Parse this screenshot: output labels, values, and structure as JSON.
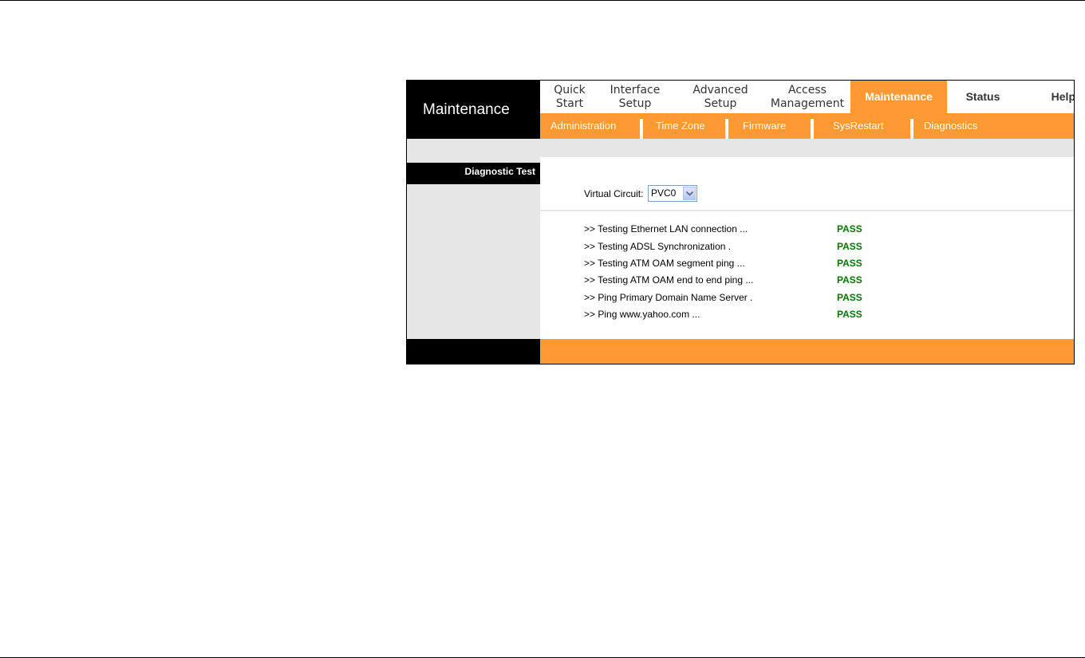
{
  "page": {
    "section_title": "Maintenance"
  },
  "nav": {
    "items": [
      {
        "label_line1": "Quick",
        "label_line2": "Start"
      },
      {
        "label_line1": "Interface",
        "label_line2": "Setup"
      },
      {
        "label_line1": "Advanced",
        "label_line2": "Setup"
      },
      {
        "label_line1": "Access",
        "label_line2": "Management"
      },
      {
        "label": "Maintenance",
        "active": true
      },
      {
        "label": "Status"
      },
      {
        "label": "Help"
      }
    ]
  },
  "subnav": {
    "items": [
      "Administration",
      "Time Zone",
      "Firmware",
      "SysRestart",
      "Diagnostics"
    ]
  },
  "left": {
    "section_label": "Diagnostic Test"
  },
  "virtual_circuit": {
    "label": "Virtual Circuit:",
    "value": "PVC0"
  },
  "tests": [
    {
      "name": ">> Testing Ethernet LAN connection ...",
      "result": "PASS"
    },
    {
      "name": ">> Testing ADSL Synchronization .",
      "result": "PASS"
    },
    {
      "name": ">> Testing ATM OAM segment ping ...",
      "result": "PASS"
    },
    {
      "name": ">> Testing ATM OAM end to end ping ...",
      "result": "PASS"
    },
    {
      "name": ">> Ping Primary Domain Name Server .",
      "result": "PASS"
    },
    {
      "name": ">> Ping www.yahoo.com ...",
      "result": "PASS"
    }
  ],
  "colors": {
    "accent": "#ff9933",
    "panel_gray": "#e6e6e6",
    "pass_green": "#007700"
  }
}
